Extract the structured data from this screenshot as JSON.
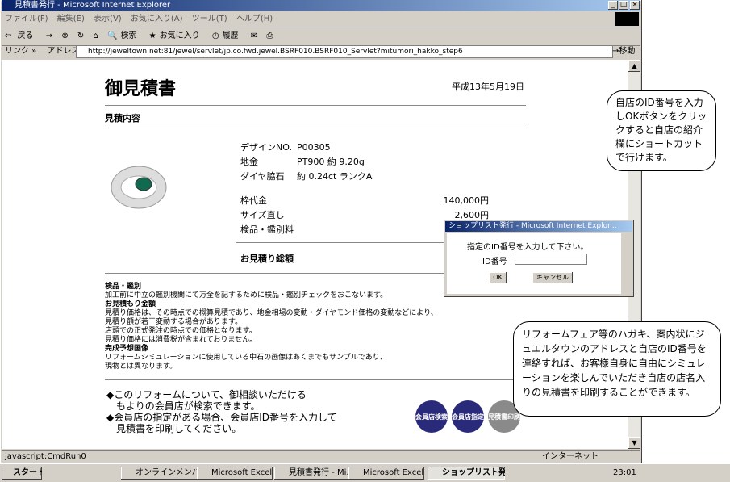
{
  "window": {
    "title": "見積書発行 - Microsoft Internet Explorer",
    "controls": [
      "_",
      "□",
      "×"
    ]
  },
  "menu": [
    "ファイル(F)",
    "編集(E)",
    "表示(V)",
    "お気に入り(A)",
    "ツール(T)",
    "ヘルプ(H)"
  ],
  "toolbar": {
    "back": "戻る",
    "forward": "→",
    "search": "検索",
    "favorites": "お気に入り",
    "history": "履歴"
  },
  "address": {
    "links_label": "リンク »",
    "label": "アドレス(D)",
    "url": "http://jeweltown.net:81/jewel/servlet/jp.co.fwd.jewel.BSRF010.BSRF010_Servlet?mitumori_hakko_step6",
    "go": "移動"
  },
  "doc": {
    "title": "御見積書",
    "date": "平成13年5月19日",
    "section": "見積内容",
    "specs": [
      {
        "label": "デザインNO.",
        "value": "P00305"
      },
      {
        "label": "地金",
        "value": "PT900 約 9.20g"
      },
      {
        "label": "ダイヤ脇石",
        "value": "約 0.24ct ランクA"
      }
    ],
    "costs": [
      {
        "label": "枠代金",
        "value": "140,000円"
      },
      {
        "label": "サイズ直し",
        "value": "2,600円"
      },
      {
        "label": "検品・鑑別料",
        "value": ""
      }
    ],
    "total_label": "お見積り総額",
    "notes": [
      {
        "head": "検品・鑑別",
        "lines": [
          "加工前に中立の鑑別機関にて万全を記するために検品・鑑別チェックをおこないます。"
        ]
      },
      {
        "head": "お見積もり金額",
        "lines": [
          "見積り価格は、その時点での概算見積であり、地金相場の変動・ダイヤモンド価格の変動などにより、",
          "見積り額が若干変動する場合があります。",
          "店頭での正式発注の時点での価格となります。",
          "見積り価格には消費税が含まれておりません。"
        ]
      },
      {
        "head": "完成予想画像",
        "lines": [
          "リフォームシミュレーションに使用している中石の画像はあくまでもサンプルであり、",
          "現物とは異なります。"
        ]
      }
    ],
    "footer_lines": [
      "◆このリフォームについて、御相談いただける",
      "　もよりの会員店が検索できます。",
      "◆会員店の指定がある場合、会員店ID番号を入力して",
      "　見積書を印刷してください。"
    ],
    "buttons": [
      {
        "label": "会員店検索",
        "color": "#2a2a7a"
      },
      {
        "label": "会員店指定",
        "color": "#2a2a7a"
      },
      {
        "label": "見積書印刷",
        "color": "#8a8a8a"
      }
    ]
  },
  "popup": {
    "title": "ショップリスト発行 - Microsoft Internet Explor...",
    "prompt": "指定のID番号を入力して下さい。",
    "field_label": "ID番号",
    "ok": "OK",
    "cancel": "キャンセル"
  },
  "status": {
    "text": "javascript:CmdRun0",
    "zone": "インターネット"
  },
  "taskbar": {
    "start": "スタート",
    "tasks": [
      "オンラインメンバー登録",
      "Microsoft Excel",
      "見積書発行 - Mi...",
      "Microsoft Excel",
      "ショップリスト発..."
    ],
    "clock": "23:01"
  },
  "callouts": {
    "top": "自店のID番号を入力しOKボタンをクリックすると自店の紹介欄にショートカットで行けます。",
    "bottom": "リフォームフェア等のハガキ、案内状にジュエルタウンのアドレスと自店のID番号を連絡すれば、お客様自身に自由にシミュレーションを楽しんでいただき自店の店名入りの見積書を印刷することができます。"
  }
}
